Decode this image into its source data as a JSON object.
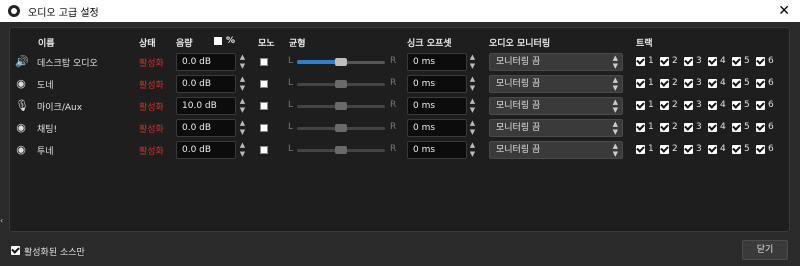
{
  "window": {
    "title": "오디오 고급 설정",
    "close_icon": "close-icon"
  },
  "headers": {
    "name": "이름",
    "status": "상태",
    "volume": "음량",
    "percent": "%",
    "mono": "모노",
    "balance": "균형",
    "sync_offset": "싱크 오프셋",
    "audio_monitoring": "오디오 모니터링",
    "tracks": "트랙"
  },
  "sources": [
    {
      "icon": "speaker-icon",
      "name": "데스크탑 오디오",
      "status": "활성화",
      "volume": "0.0 dB",
      "balance": 0.5,
      "sync": "0 ms",
      "monitoring": "모니터링 끔",
      "tracks": [
        "1",
        "2",
        "3",
        "4",
        "5",
        "6"
      ]
    },
    {
      "icon": "globe-icon",
      "name": "도네",
      "status": "활성화",
      "volume": "0.0 dB",
      "balance": 0.5,
      "sync": "0 ms",
      "monitoring": "모니터링 끔",
      "tracks": [
        "1",
        "2",
        "3",
        "4",
        "5",
        "6"
      ]
    },
    {
      "icon": "microphone-icon",
      "name": "마이크/Aux",
      "status": "활성화",
      "volume": "10.0 dB",
      "balance": 0.5,
      "sync": "0 ms",
      "monitoring": "모니터링 끔",
      "tracks": [
        "1",
        "2",
        "3",
        "4",
        "5",
        "6"
      ]
    },
    {
      "icon": "globe-icon",
      "name": "채팅!",
      "status": "활성화",
      "volume": "0.0 dB",
      "balance": 0.5,
      "sync": "0 ms",
      "monitoring": "모니터링 끔",
      "tracks": [
        "1",
        "2",
        "3",
        "4",
        "5",
        "6"
      ]
    },
    {
      "icon": "globe-icon",
      "name": "투네",
      "status": "활성화",
      "volume": "0.0 dB",
      "balance": 0.5,
      "sync": "0 ms",
      "monitoring": "모니터링 끔",
      "tracks": [
        "1",
        "2",
        "3",
        "4",
        "5",
        "6"
      ]
    }
  ],
  "balance_labels": {
    "left": "L",
    "right": "R"
  },
  "footer": {
    "active_only_label": "활성화된 소스만",
    "close_button": "닫기"
  },
  "colors": {
    "status_active": "#d32f2f",
    "balance_fill": "#2d7fd3",
    "panel_bg": "#1e1e1e",
    "window_bg": "#2a2a2a"
  }
}
